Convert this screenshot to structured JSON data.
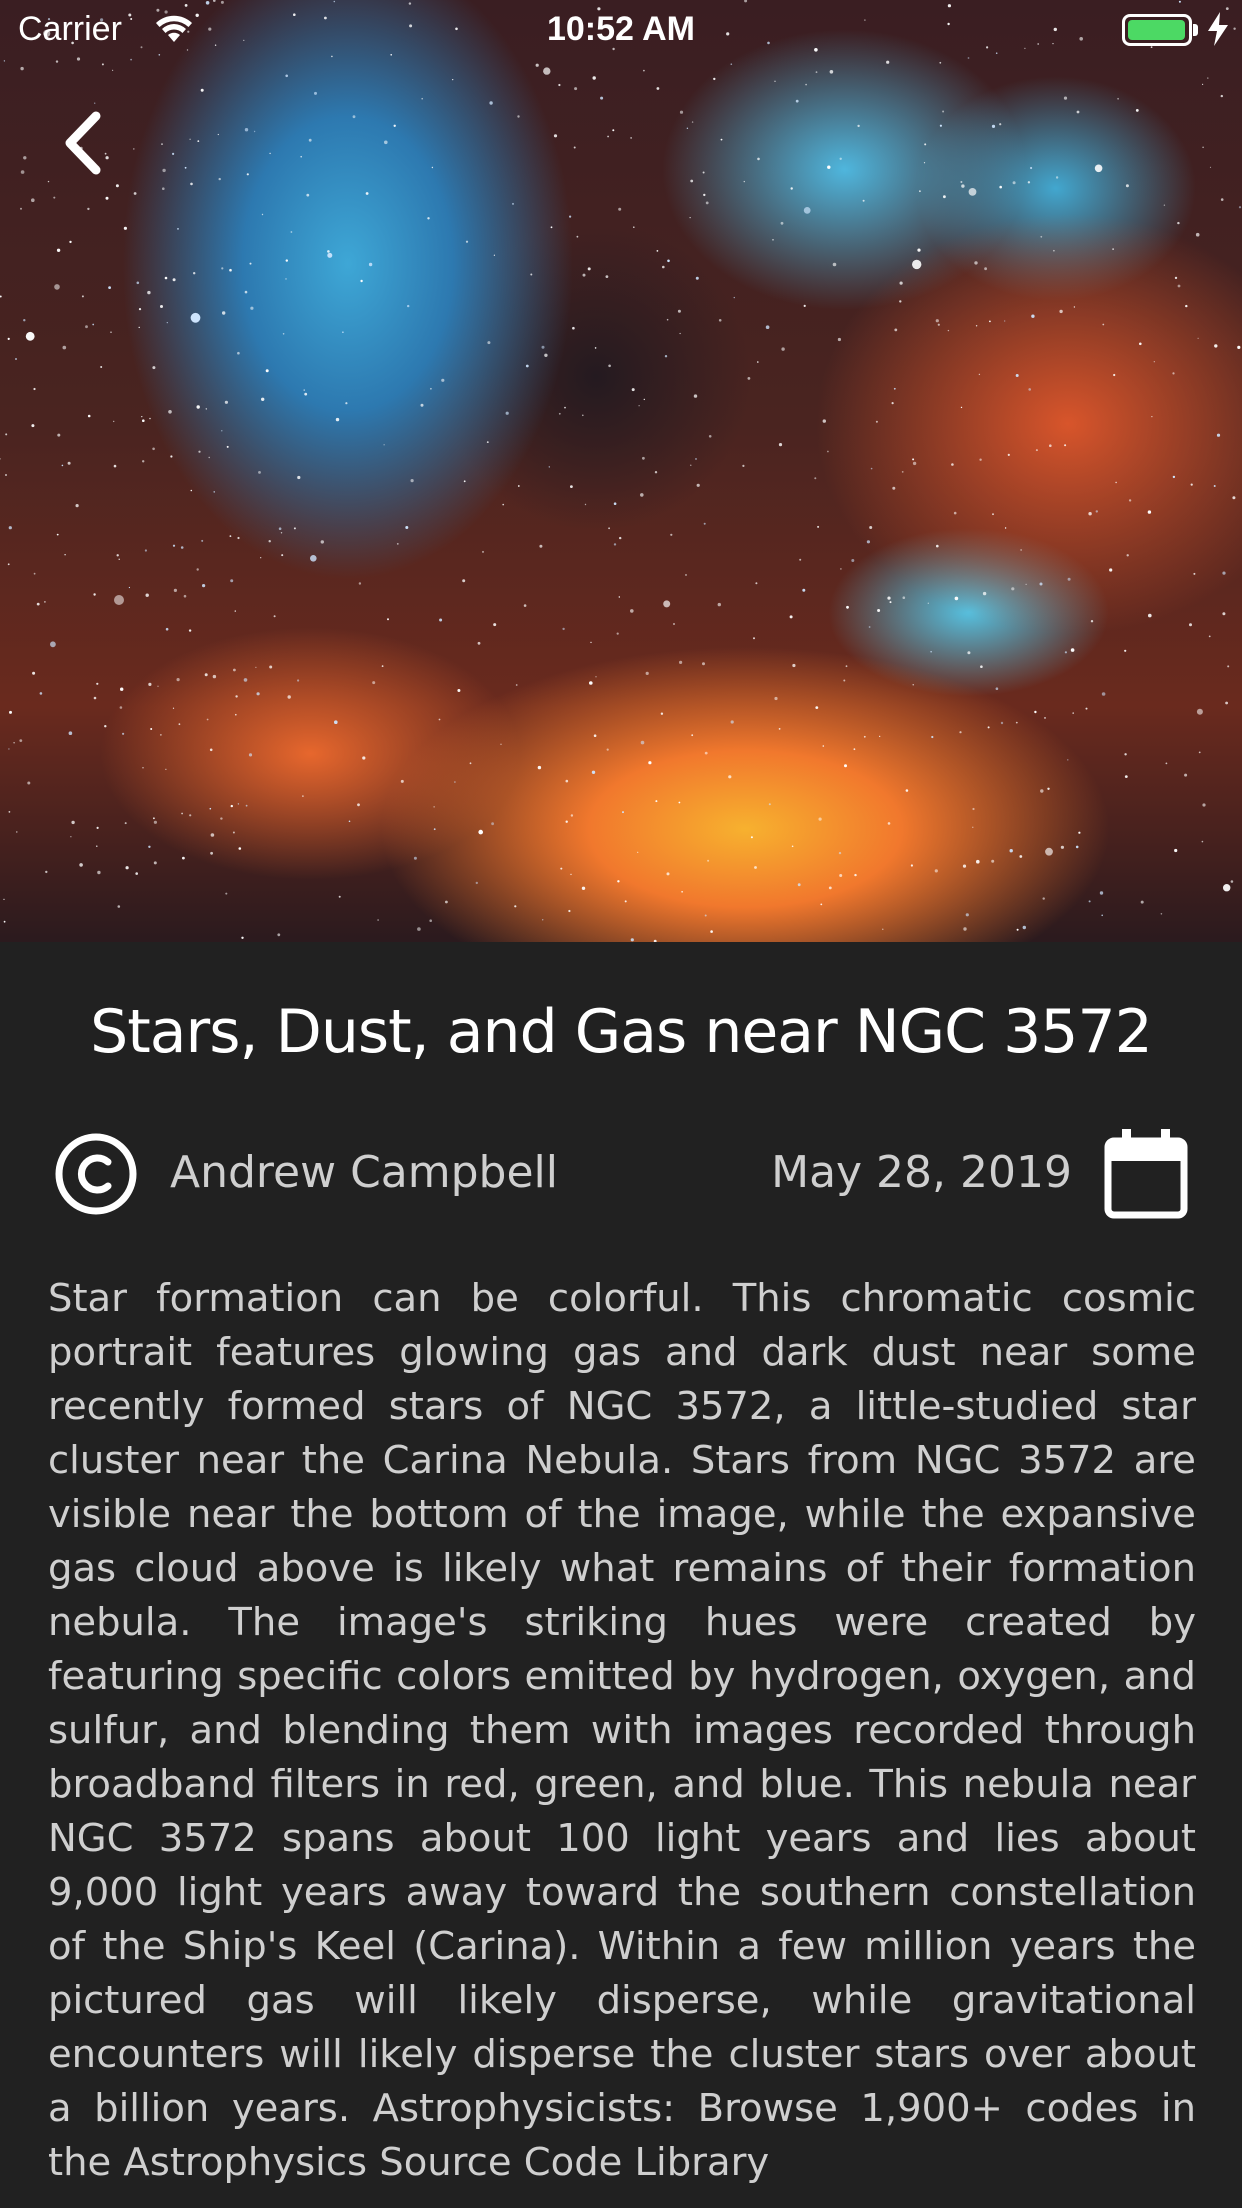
{
  "status_bar": {
    "carrier": "Carrier",
    "time": "10:52 AM",
    "battery_color": "#4cd964",
    "icons": [
      "wifi-icon",
      "battery-icon",
      "charging-bolt-icon"
    ]
  },
  "navigation": {
    "back_icon": "chevron-left-icon"
  },
  "hero": {
    "image": "nebula-photo"
  },
  "article": {
    "title": "Stars, Dust, and Gas near NGC 3572",
    "author": "Andrew Campbell",
    "author_icon": "copyright-icon",
    "date": "May 28, 2019",
    "date_icon": "calendar-icon",
    "description": "Star formation can be colorful.  This chromatic cosmic portrait features glowing gas and dark dust near some recently formed stars of NGC 3572, a little-studied star cluster near the Carina Nebula.  Stars from NGC 3572 are visible near the bottom of the image, while the expansive gas cloud above is likely what remains of their formation nebula.  The image's striking hues were created by featuring specific colors emitted by hydrogen, oxygen, and sulfur, and blending them with images recorded through broadband filters in red, green, and blue. This nebula near NGC 3572 spans about 100 light years and lies about 9,000 light years away toward the southern constellation of the Ship's Keel (Carina).  Within a few million years the pictured gas will likely disperse, while gravitational encounters will likely disperse the cluster stars over about a billion years.   Astrophysicists: Browse 1,900+ codes in the Astrophysics Source Code Library"
  },
  "colors": {
    "background": "#212121",
    "text_primary": "#ffffff",
    "text_secondary": "#cfcfcf"
  }
}
